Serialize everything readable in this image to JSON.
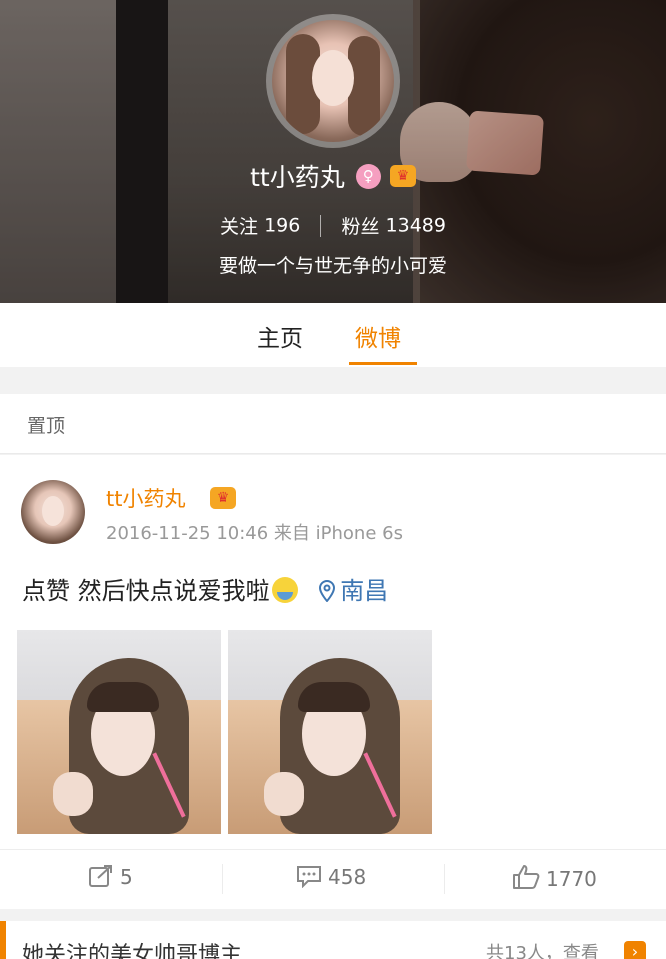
{
  "profile": {
    "name": "tt小药丸",
    "gender_badge": "♀",
    "vip_badge": "♛",
    "following_label": "关注",
    "following_count": "196",
    "followers_label": "粉丝",
    "followers_count": "13489",
    "bio": "要做一个与世无争的小可爱"
  },
  "tabs": [
    {
      "label": "主页",
      "active": false
    },
    {
      "label": "微博",
      "active": true
    }
  ],
  "pinned": {
    "label": "置顶"
  },
  "post": {
    "author": "tt小药丸",
    "vip_badge": "♛",
    "meta": "2016-11-25 10:46 来自 iPhone 6s",
    "text": "点赞 然后快点说爱我啦",
    "location": "南昌",
    "photo_count": 2,
    "actions": {
      "repost": "5",
      "comment": "458",
      "like": "1770"
    }
  },
  "recommend": {
    "title": "她关注的美女帅哥博主",
    "count": "共13人，查看",
    "arrow": "›"
  },
  "colors": {
    "accent": "#f08300",
    "location_blue": "#3f77b3",
    "gender_pink": "#f59fc0",
    "vip_gold": "#f5a623"
  },
  "icons": [
    "female-icon",
    "vip-crown-icon",
    "location-pin-icon",
    "repost-icon",
    "comment-icon",
    "like-icon",
    "arrow-right-icon",
    "emoji-icon"
  ]
}
